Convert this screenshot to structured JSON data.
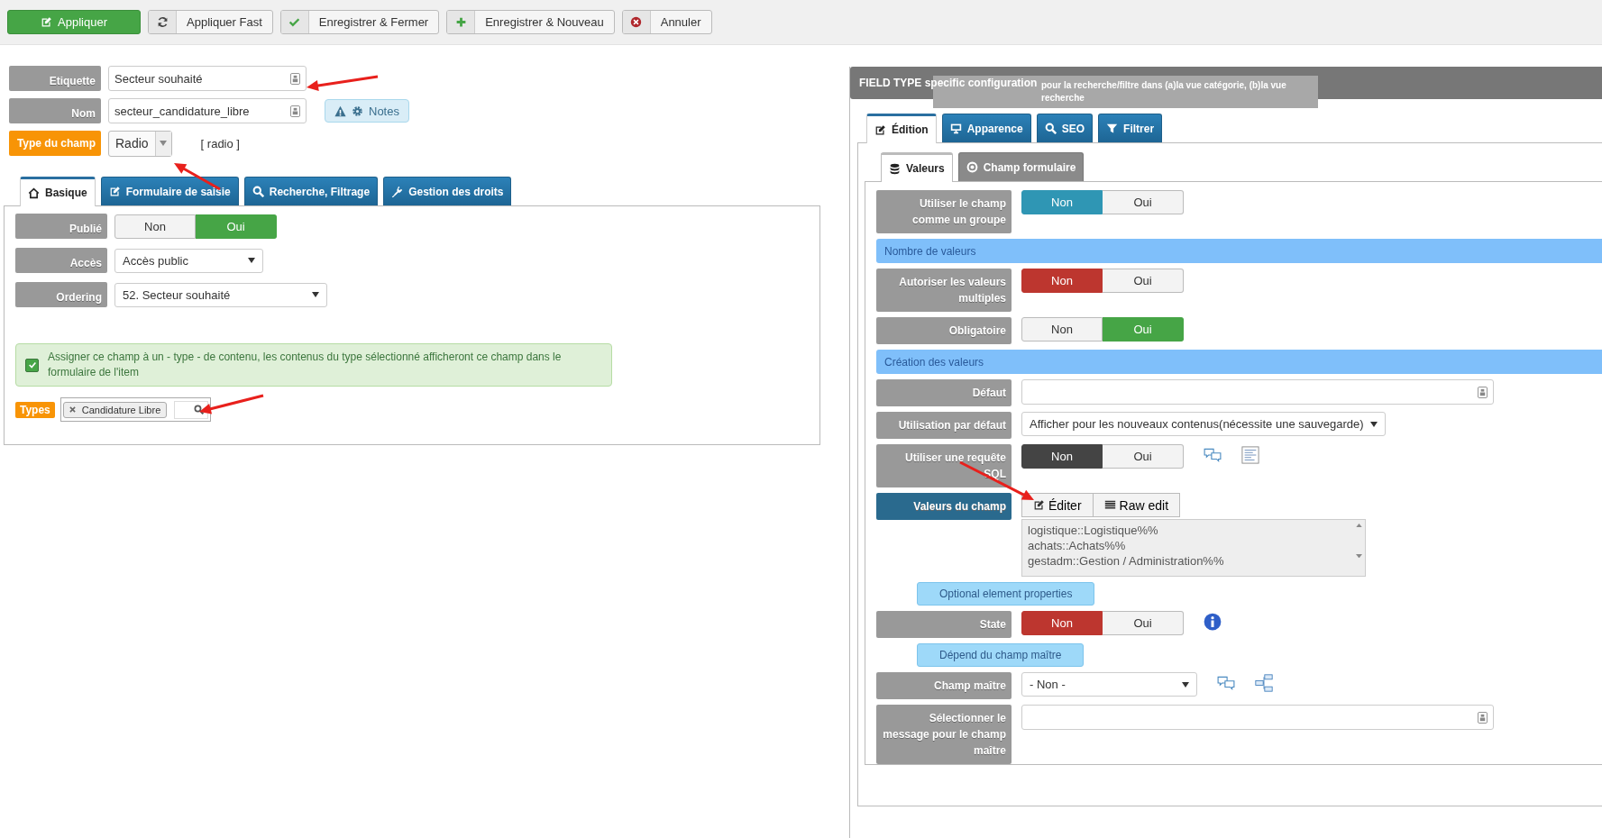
{
  "toolbar": [
    {
      "label": "Appliquer",
      "kind": "primary"
    },
    {
      "label": "Appliquer Fast",
      "kind": "default"
    },
    {
      "label": "Enregistrer & Fermer",
      "kind": "default"
    },
    {
      "label": "Enregistrer & Nouveau",
      "kind": "default"
    },
    {
      "label": "Annuler",
      "kind": "default"
    }
  ],
  "main_fields": [
    {
      "label": "Etiquette",
      "kind": "text",
      "value": "Secteur souhaité"
    },
    {
      "label": "Nom",
      "kind": "text",
      "value": "secteur_candidature_libre",
      "notes": "Notes"
    },
    {
      "label": "Type du champ",
      "kind": "type",
      "value": "Radio",
      "hint": "[ radio ]"
    }
  ],
  "left_tabs": [
    {
      "label": "Basique",
      "selected": true
    },
    {
      "label": "Formulaire de saisie",
      "selected": false
    },
    {
      "label": "Recherche, Filtrage",
      "selected": false
    },
    {
      "label": "Gestion des droits",
      "selected": false
    }
  ],
  "basic_rows": [
    {
      "label": "Publié",
      "kind": "toggle",
      "color": "#46a546",
      "options": [
        {
          "label": "Non",
          "selected": false
        },
        {
          "label": "Oui",
          "selected": true
        }
      ]
    },
    {
      "label": "Accès",
      "kind": "select",
      "value": "Accès public"
    },
    {
      "label": "Ordering",
      "kind": "select",
      "value": "52. Secteur souhaité"
    }
  ],
  "assign_notice": {
    "text": "Assigner ce champ à un - type - de contenu, les contenus du type sélectionné afficheront ce champ dans le formulaire de l'item",
    "checked": true
  },
  "types": {
    "label": "Types",
    "tags": [
      "Candidature Libre"
    ]
  },
  "config": {
    "title": "FIELD TYPE specific configuration",
    "tooltip": "pour la recherche/filtre dans (a)la vue catégorie, (b)la vue recherche",
    "tabs": [
      {
        "label": "Édition",
        "selected": true
      },
      {
        "label": "Apparence",
        "selected": false
      },
      {
        "label": "SEO",
        "selected": false
      },
      {
        "label": "Filtrer",
        "selected": false
      }
    ],
    "subtabs": [
      {
        "label": "Valeurs",
        "selected": true
      },
      {
        "label": "Champ formulaire",
        "selected": false
      }
    ],
    "rows": [
      {
        "kind": "toggle",
        "label": "Utiliser le champ comme un groupe",
        "color": "#2f96b4",
        "options": [
          {
            "label": "Non",
            "selected": true
          },
          {
            "label": "Oui",
            "selected": false
          }
        ]
      },
      {
        "kind": "section",
        "label": "Nombre de valeurs"
      },
      {
        "kind": "toggle",
        "label": "Autoriser les valeurs multiples",
        "color": "#bd362f",
        "options": [
          {
            "label": "Non",
            "selected": true
          },
          {
            "label": "Oui",
            "selected": false
          }
        ]
      },
      {
        "kind": "toggle",
        "label": "Obligatoire",
        "color": "#46a546",
        "options": [
          {
            "label": "Non",
            "selected": false
          },
          {
            "label": "Oui",
            "selected": true
          }
        ]
      },
      {
        "kind": "section",
        "label": "Création des valeurs"
      },
      {
        "kind": "text",
        "label": "Défaut"
      },
      {
        "kind": "select",
        "label": "Utilisation par défaut",
        "value": "Afficher pour les nouveaux contenus(nécessite une sauvegarde)"
      },
      {
        "kind": "toggle",
        "label": "Utiliser une requête SQL",
        "color": "#444444",
        "options": [
          {
            "label": "Non",
            "selected": true
          },
          {
            "label": "Oui",
            "selected": false
          }
        ]
      },
      {
        "kind": "values",
        "label": "Valeurs du champ",
        "buttons": [
          "Éditer",
          "Raw edit"
        ],
        "lines": [
          "logistique::Logistique%%",
          "achats::Achats%%",
          "gestadm::Gestion / Administration%%"
        ]
      },
      {
        "kind": "pill",
        "label": "Optional element properties"
      },
      {
        "kind": "toggle",
        "label": "State",
        "color": "#bd362f",
        "options": [
          {
            "label": "Non",
            "selected": true
          },
          {
            "label": "Oui",
            "selected": false
          }
        ]
      },
      {
        "kind": "pill",
        "label": "Dépend du champ maître"
      },
      {
        "kind": "select",
        "label": "Champ maître",
        "value": "- Non -"
      },
      {
        "kind": "text",
        "label": "Sélectionner le message pour le champ maître"
      }
    ]
  }
}
